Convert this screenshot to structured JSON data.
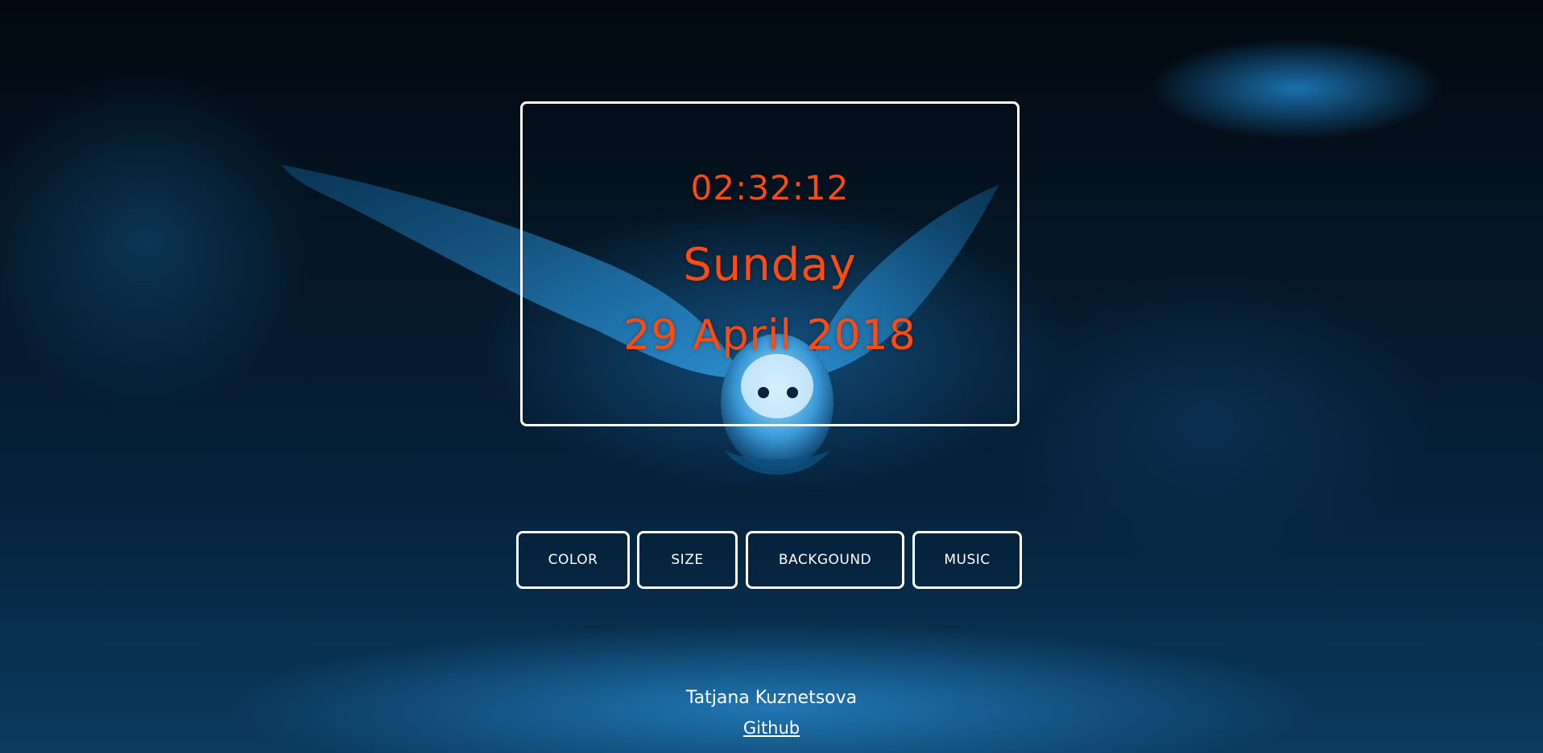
{
  "clock": {
    "time": "02:32:12",
    "day": "Sunday",
    "date": "29 April 2018"
  },
  "buttons": {
    "color": "COLOR",
    "size": "SIZE",
    "background": "BACKGOUND",
    "music": "MUSIC"
  },
  "footer": {
    "author": "Tatjana Kuznetsova",
    "link_label": "Github"
  },
  "colors": {
    "clock_text": "#ff4a12",
    "frame_border": "#ffffff",
    "button_text": "#ffffff",
    "background_dark": "#041523",
    "background_glow": "#1e82c8"
  },
  "icons": {
    "background_image": "owl-in-flight-image"
  }
}
